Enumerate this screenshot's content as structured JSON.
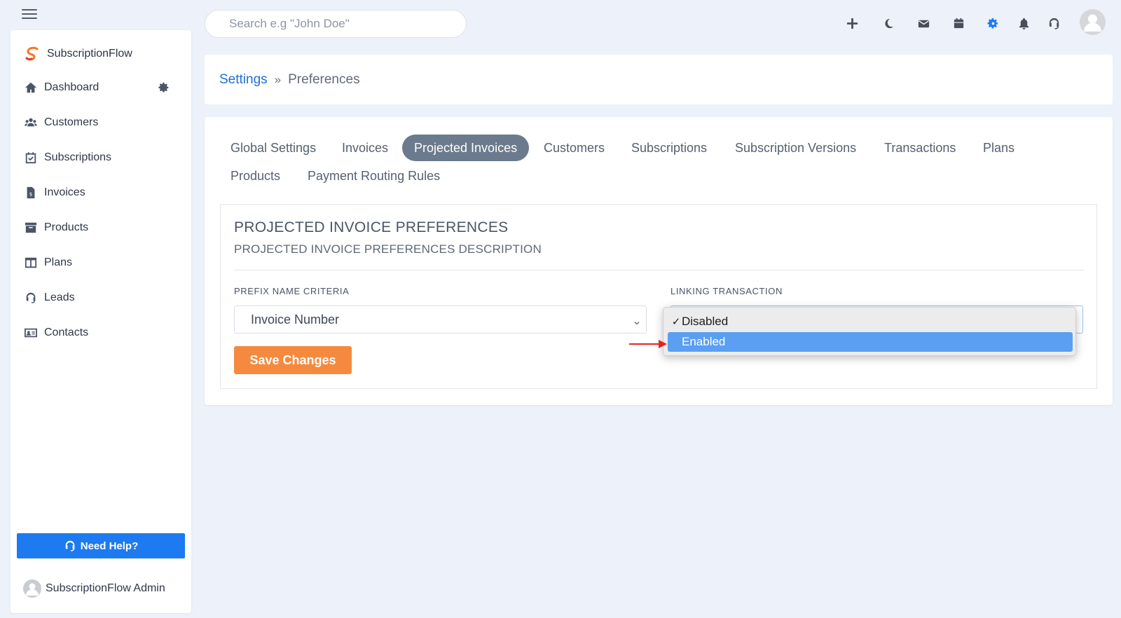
{
  "search": {
    "placeholder": "Search e.g \"John Doe\""
  },
  "brand": {
    "name": "SubscriptionFlow"
  },
  "sidebar": {
    "items": [
      {
        "label": "Dashboard",
        "icon": "home-icon"
      },
      {
        "label": "Customers",
        "icon": "users-icon"
      },
      {
        "label": "Subscriptions",
        "icon": "calendar-check-icon"
      },
      {
        "label": "Invoices",
        "icon": "invoice-icon"
      },
      {
        "label": "Products",
        "icon": "archive-icon"
      },
      {
        "label": "Plans",
        "icon": "columns-icon"
      },
      {
        "label": "Leads",
        "icon": "headset-icon"
      },
      {
        "label": "Contacts",
        "icon": "contact-card-icon"
      }
    ],
    "help_label": "Need Help?",
    "user_name": "SubscriptionFlow Admin"
  },
  "topbar": {
    "icons": [
      "plus-icon",
      "moon-icon",
      "mail-icon",
      "calendar-icon",
      "gear-icon",
      "bell-icon",
      "headset-icon",
      "avatar"
    ],
    "accent_icon_color": "#1d7af0"
  },
  "breadcrumb": {
    "parent": "Settings",
    "separator": "»",
    "current": "Preferences"
  },
  "tabs": [
    {
      "label": "Global Settings",
      "active": false
    },
    {
      "label": "Invoices",
      "active": false
    },
    {
      "label": "Projected Invoices",
      "active": true
    },
    {
      "label": "Customers",
      "active": false
    },
    {
      "label": "Subscriptions",
      "active": false
    },
    {
      "label": "Subscription Versions",
      "active": false
    },
    {
      "label": "Transactions",
      "active": false
    },
    {
      "label": "Plans",
      "active": false
    },
    {
      "label": "Products",
      "active": false
    },
    {
      "label": "Payment Routing Rules",
      "active": false
    }
  ],
  "panel": {
    "title": "PROJECTED INVOICE PREFERENCES",
    "description": "PROJECTED INVOICE PREFERENCES DESCRIPTION",
    "prefix_label": "PREFIX NAME CRITERIA",
    "prefix_value": "Invoice Number",
    "linking_label": "LINKING TRANSACTION",
    "save_label": "Save Changes"
  },
  "dropdown": {
    "options": [
      {
        "label": "Disabled",
        "checked": true,
        "highlighted": false
      },
      {
        "label": "Enabled",
        "checked": false,
        "highlighted": true
      }
    ],
    "check_glyph": "✓"
  },
  "colors": {
    "primary": "#1d7af0",
    "save": "#f58a3e",
    "active_tab": "#6c7a8d",
    "highlight": "#5a9ff2",
    "arrow": "#e8231b"
  }
}
